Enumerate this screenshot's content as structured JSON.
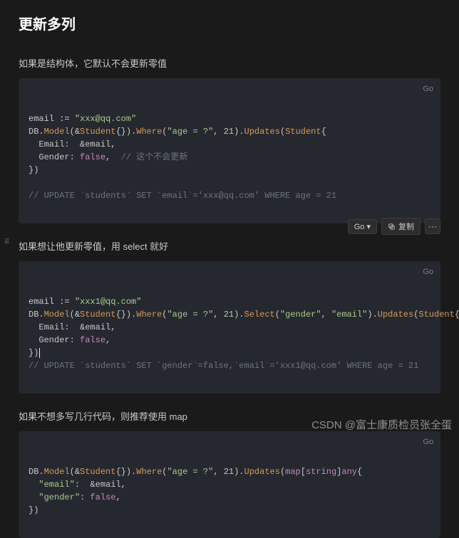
{
  "title": "更新多列",
  "sections": [
    {
      "desc": "如果是结构体，它默认不会更新零值",
      "lang": "Go",
      "code": {
        "l1_a": "email ",
        "l1_b": ":= ",
        "l1_c": "\"xxx@qq.com\"",
        "l2_a": "DB.",
        "l2_b": "Model",
        "l2_c": "(&",
        "l2_d": "Student",
        "l2_e": "{}).",
        "l2_f": "Where",
        "l2_g": "(",
        "l2_h": "\"age = ?\"",
        "l2_i": ", ",
        "l2_j": "21",
        "l2_k": ").",
        "l2_l": "Updates",
        "l2_m": "(",
        "l2_n": "Student",
        "l2_o": "{",
        "l3_a": "  Email:  &email,",
        "l4_a": "  Gender: ",
        "l4_b": "false",
        "l4_c": ",  ",
        "l4_d": "// 这个不会更新",
        "l5_a": "})",
        "l6": "",
        "l7": "// UPDATE `students` SET `email`='xxx@qq.com' WHERE age = 21"
      }
    },
    {
      "desc": "如果想让他更新零值，用 select 就好",
      "lang": "Go",
      "toolbar": {
        "go": "Go ▾",
        "copy": "复制",
        "more": "···"
      },
      "code": {
        "l1_a": "email ",
        "l1_b": ":= ",
        "l1_c": "\"xxx1@qq.com\"",
        "l2_a": "DB.",
        "l2_b": "Model",
        "l2_c": "(&",
        "l2_d": "Student",
        "l2_e": "{}).",
        "l2_f": "Where",
        "l2_g": "(",
        "l2_h": "\"age = ?\"",
        "l2_i": ", ",
        "l2_j": "21",
        "l2_k": ").",
        "l2_l": "Select",
        "l2_m": "(",
        "l2_n": "\"gender\"",
        "l2_o": ", ",
        "l2_p": "\"email\"",
        "l2_q": ").",
        "l2_r": "Updates",
        "l2_s": "(",
        "l2_t": "Student",
        "l2_u": "{",
        "l3_a": "  Email:  &email,",
        "l4_a": "  Gender: ",
        "l4_b": "false",
        "l4_c": ",",
        "l5_a": "})",
        "l6": "// UPDATE `students` SET `gender`=false,`email`='xxx1@qq.com' WHERE age = 21"
      }
    },
    {
      "desc": "如果不想多写几行代码，则推荐使用 map",
      "lang": "Go",
      "code": {
        "l1_a": "DB.",
        "l1_b": "Model",
        "l1_c": "(&",
        "l1_d": "Student",
        "l1_e": "{}).",
        "l1_f": "Where",
        "l1_g": "(",
        "l1_h": "\"age = ?\"",
        "l1_i": ", ",
        "l1_j": "21",
        "l1_k": ").",
        "l1_l": "Updates",
        "l1_m": "(",
        "l1_n": "map",
        "l1_o": "[",
        "l1_p": "string",
        "l1_q": "]",
        "l1_r": "any",
        "l1_s": "{",
        "l2_a": "  ",
        "l2_b": "\"email\"",
        "l2_c": ":  &email,",
        "l3_a": "  ",
        "l3_b": "\"gender\"",
        "l3_c": ": ",
        "l3_d": "false",
        "l3_e": ",",
        "l4_a": "})"
      }
    }
  ],
  "watermark": "CSDN @富士康质检员张全蛋"
}
